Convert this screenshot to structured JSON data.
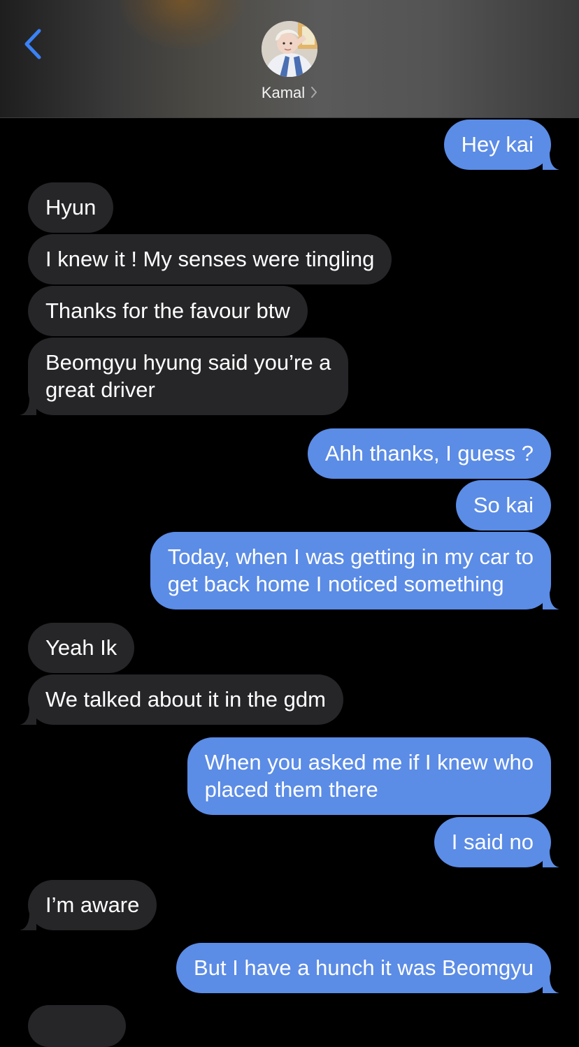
{
  "header": {
    "contact_name": "Kamal",
    "back_icon": "chevron-left-icon",
    "disclosure_icon": "chevron-right-icon",
    "accent_color": "#3a82f7"
  },
  "messages": [
    {
      "direction": "out",
      "text": "Hey kai"
    },
    {
      "direction": "in",
      "text": "Hyun"
    },
    {
      "direction": "in",
      "text": "I knew it ! My senses were tingling"
    },
    {
      "direction": "in",
      "text": "Thanks for the favour btw"
    },
    {
      "direction": "in",
      "lines": [
        "Beomgyu hyung said you’re a",
        "great driver"
      ]
    },
    {
      "direction": "out",
      "text": "Ahh thanks, I guess ?"
    },
    {
      "direction": "out",
      "text": "So kai"
    },
    {
      "direction": "out",
      "lines": [
        "Today, when I was getting in my car to",
        "get back home I noticed something"
      ]
    },
    {
      "direction": "in",
      "text": "Yeah Ik"
    },
    {
      "direction": "in",
      "text": "We talked about it in the gdm"
    },
    {
      "direction": "out",
      "lines": [
        "When you asked me if I knew who",
        "placed them there"
      ]
    },
    {
      "direction": "out",
      "text": "I said no"
    },
    {
      "direction": "in",
      "text": "I’m aware"
    },
    {
      "direction": "out",
      "text": "But I have a hunch it was Beomgyu"
    }
  ],
  "colors": {
    "incoming_bubble": "#262629",
    "outgoing_bubble": "#5b8ce6",
    "background": "#000000"
  }
}
